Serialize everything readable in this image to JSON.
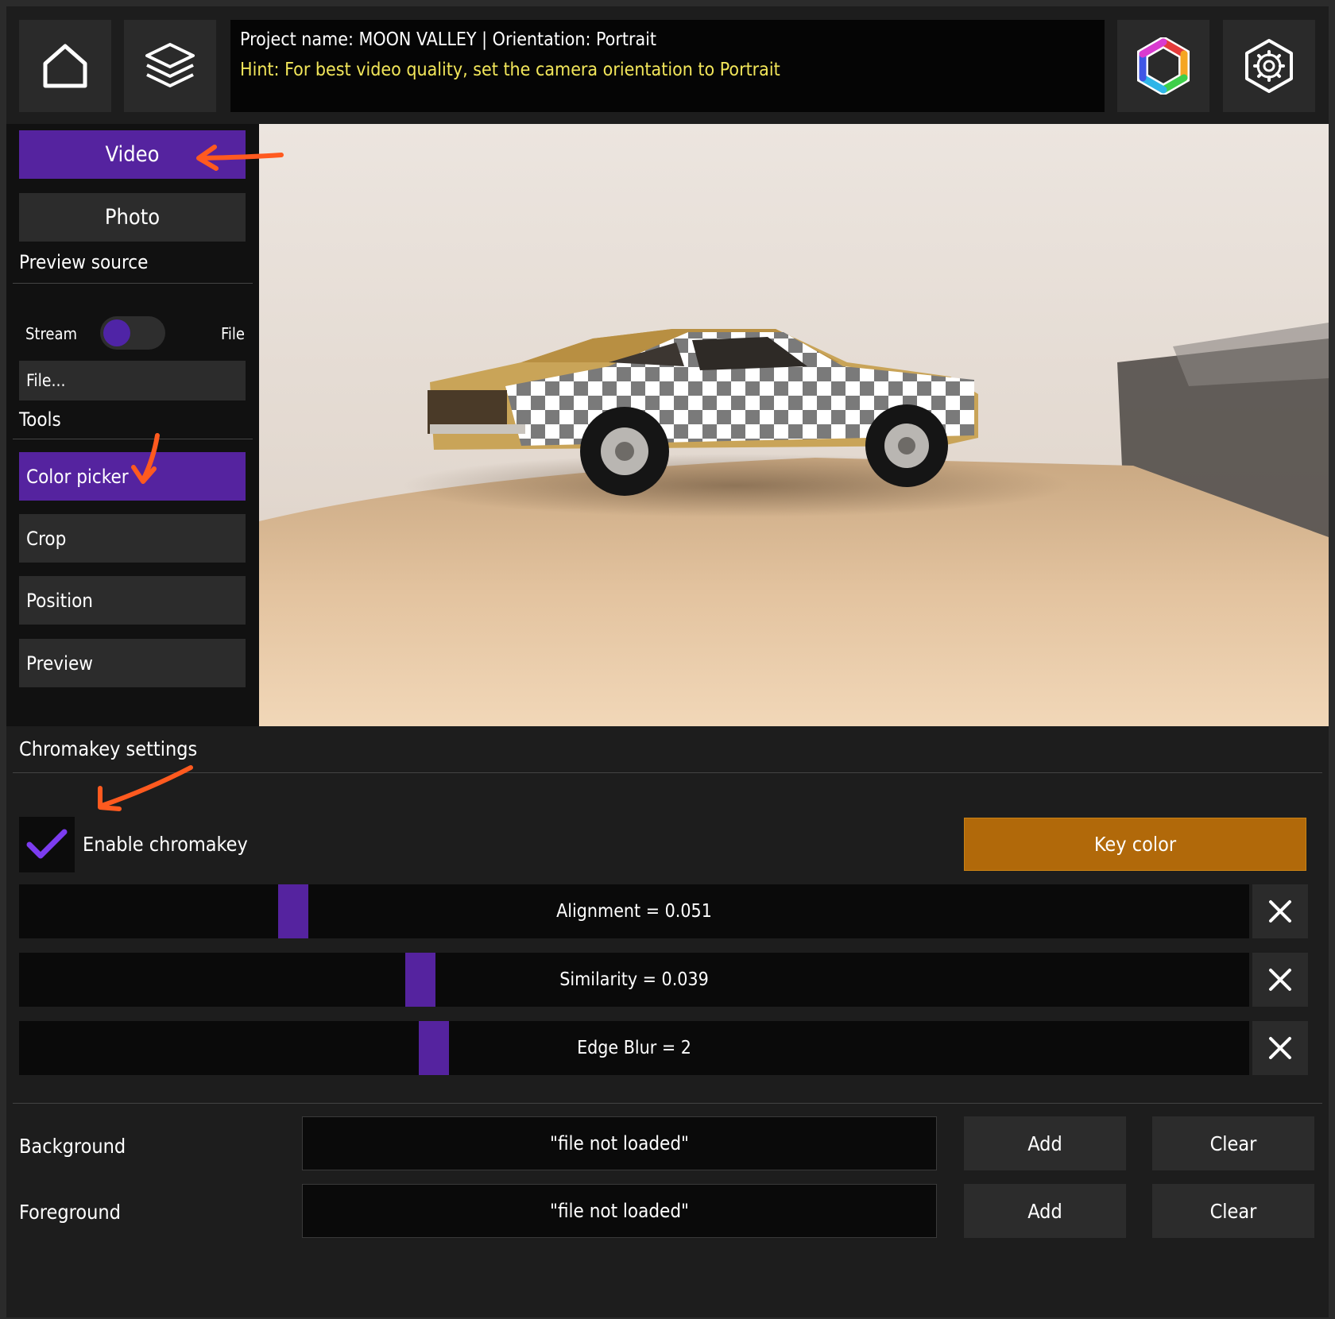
{
  "header": {
    "project_line": "Project name: MOON VALLEY | Orientation: Portrait",
    "hint_line": "Hint: For best video quality, set the camera orientation to Portrait",
    "hint_color": "#f2e65a"
  },
  "sidebar": {
    "mode_buttons": [
      {
        "label": "Video",
        "active": true
      },
      {
        "label": "Photo",
        "active": false
      }
    ],
    "preview_source": {
      "title": "Preview source",
      "left_label": "Stream",
      "right_label": "File",
      "selected": "Stream",
      "file_button": "File..."
    },
    "tools": {
      "title": "Tools",
      "items": [
        {
          "label": "Color picker",
          "active": true
        },
        {
          "label": "Crop",
          "active": false
        },
        {
          "label": "Position",
          "active": false
        },
        {
          "label": "Preview",
          "active": false
        }
      ]
    }
  },
  "chromakey": {
    "title": "Chromakey settings",
    "enable_label": "Enable chromakey",
    "enabled": true,
    "key_color_label": "Key color",
    "key_color": "#b1690a",
    "sliders": [
      {
        "label": "Alignment = 0.051",
        "value": 0.051
      },
      {
        "label": "Similarity = 0.039",
        "value": 0.039
      },
      {
        "label": "Edge Blur = 2",
        "value": 2
      }
    ]
  },
  "layers": [
    {
      "label": "Background",
      "file": "\"file not loaded\"",
      "add": "Add",
      "clear": "Clear"
    },
    {
      "label": "Foreground",
      "file": "\"file not loaded\"",
      "add": "Add",
      "clear": "Clear"
    }
  ],
  "colors": {
    "accent": "#55239f",
    "annotation_arrow": "#ff5a1f"
  },
  "icons": [
    "home-icon",
    "layers-icon",
    "color-wheel-icon",
    "settings-gear-icon",
    "checkmark-icon",
    "close-icon"
  ]
}
